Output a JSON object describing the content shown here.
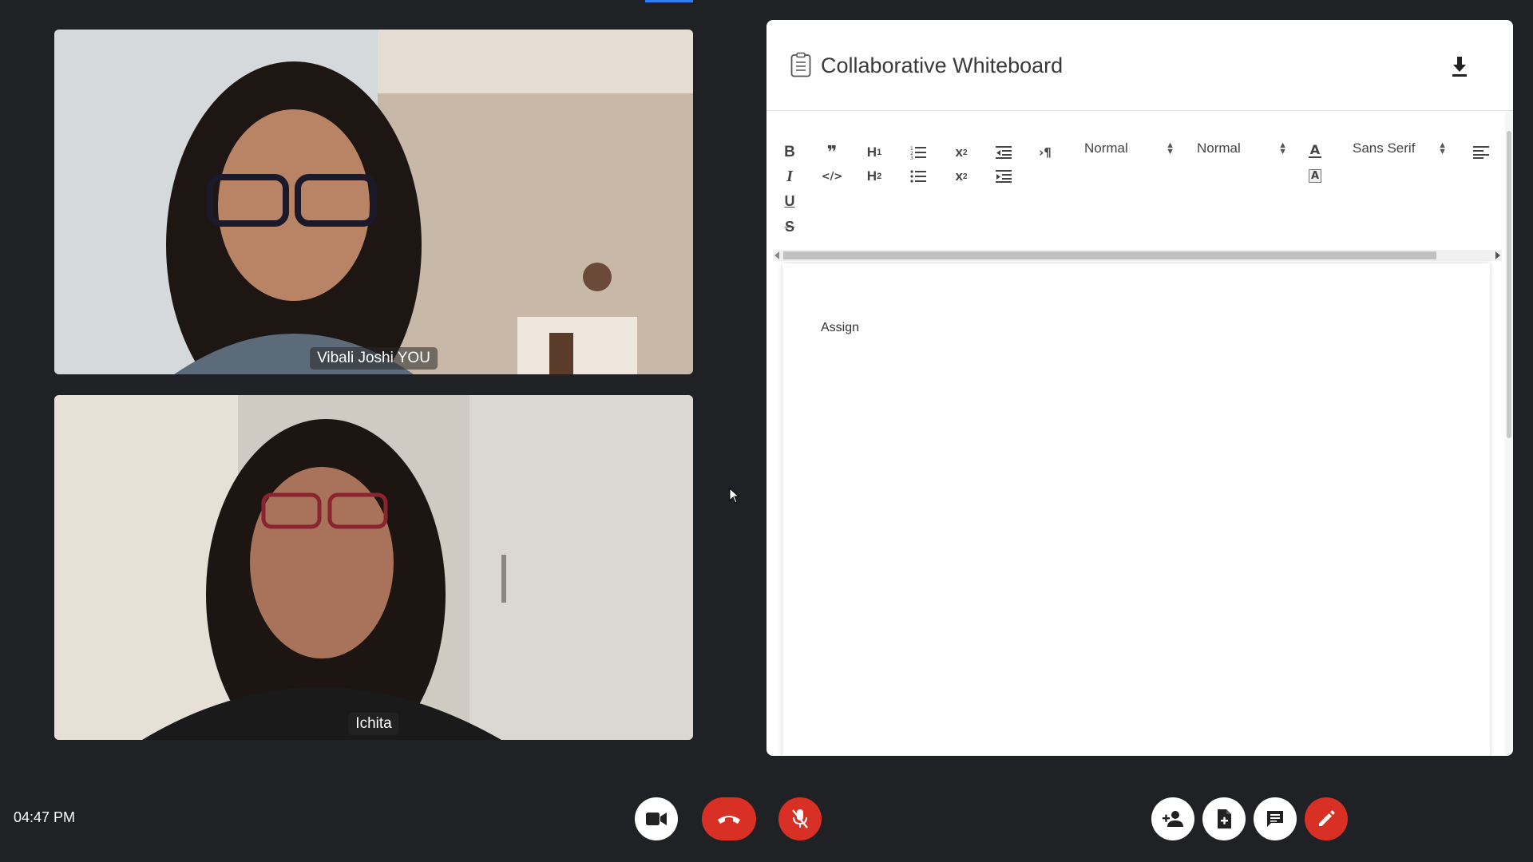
{
  "participants": [
    {
      "name": "Vibali Joshi YOU"
    },
    {
      "name": "Ichita"
    }
  ],
  "whiteboard": {
    "title": "Collaborative Whiteboard",
    "toolbar": {
      "bold": "B",
      "italic": "I",
      "underline": "U",
      "strike": "S",
      "quote": "❞",
      "code": "</>",
      "h1": "H",
      "h1_sub": "1",
      "h2": "H",
      "h2_sub": "2",
      "subscript": "x",
      "subscript_sub": "2",
      "superscript": "x",
      "superscript_sup": "2",
      "rtl": "›¶",
      "size_value": "Normal",
      "header_value": "Normal",
      "font_value": "Sans Serif",
      "color_label": "A",
      "background_label": "A"
    },
    "content": "Assign"
  },
  "clock": "04:47 PM",
  "colors": {
    "background": "#202124",
    "danger": "#d93025",
    "accent": "#2f7cf6"
  },
  "icons": {
    "video": "video-camera-icon",
    "end_call": "phone-hangup-icon",
    "mute": "mic-off-icon",
    "add_person": "person-add-icon",
    "add_file": "file-add-icon",
    "chat": "chat-icon",
    "whiteboard": "pencil-icon",
    "download": "download-icon"
  }
}
